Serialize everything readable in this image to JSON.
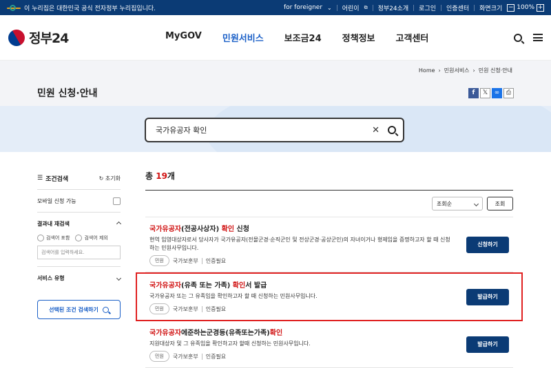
{
  "topbar": {
    "notice": "이 누리집은 대한민국 공식 전자정부 누리집입니다.",
    "links": [
      "for foreigner",
      "어린이",
      "정부24소개",
      "로그인",
      "인증센터",
      "화면크기"
    ],
    "zoom": "100%"
  },
  "header": {
    "logo": "정부24",
    "nav": [
      "MyGOV",
      "민원서비스",
      "보조금24",
      "정책정보",
      "고객센터"
    ]
  },
  "breadcrumb": [
    "Home",
    "민원서비스",
    "민원 신청·안내"
  ],
  "page": {
    "title": "민원 신청·안내"
  },
  "search": {
    "value": "국가유공자 확인"
  },
  "filter": {
    "title": "조건검색",
    "reset": "초기화",
    "mobile": "모바일 신청 가능",
    "research": "결과내 재검색",
    "radio_include": "검색어 포함",
    "radio_exclude": "검색어 제외",
    "input_placeholder": "검색어를 입력하세요.",
    "service_type": "서비스 유형",
    "apply": "선택된 조건 검색하기"
  },
  "results": {
    "total_prefix": "총 ",
    "total_count": "19",
    "total_suffix": "개",
    "sort": "조회순",
    "sort_button": "조회",
    "items": [
      {
        "title_hl1": "국가유공자",
        "title_mid": "(전공사상자) ",
        "title_hl2": "확인",
        "title_end": " 신청",
        "desc": "현역 입영대상자로서 당사자가 국가유공자(전몰군경·순직군인 및 전상군경·공상군인)의 자녀이거나 형제임을 증명하고자 할 때 신청하는 민원사무입니다.",
        "tag": "민원",
        "org": "국가보훈부",
        "auth": "인증필요",
        "button": "신청하기"
      },
      {
        "title_hl1": "국가유공자",
        "title_mid": "(유족 또는 가족) ",
        "title_hl2": "확인",
        "title_end": "서 발급",
        "desc": "국가유공자 또는 그 유족임을 확인하고자 할 때 신청하는 민원사무입니다.",
        "tag": "민원",
        "org": "국가보훈부",
        "auth": "인증필요",
        "button": "발급하기"
      },
      {
        "title_hl1": "국가유공자",
        "title_mid": "에준하는군경등(유족또는가족)",
        "title_hl2": "확인",
        "title_end": "",
        "desc": "지원대상자 및 그 유족임을 확인하고자 할때 신청하는 민원사무입니다.",
        "tag": "민원",
        "org": "국가보훈부",
        "auth": "인증필요",
        "button": "발급하기"
      }
    ]
  }
}
